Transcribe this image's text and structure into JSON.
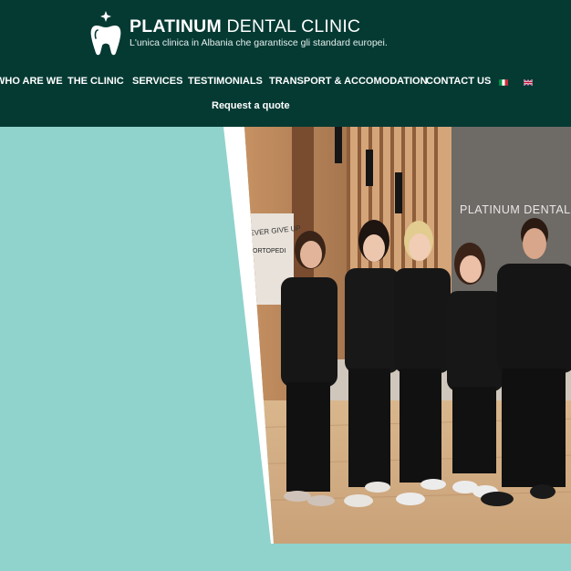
{
  "header": {
    "brand_bold": "PLATINUM",
    "brand_rest": " DENTAL CLINIC",
    "tagline": "L'unica clinica in Albania che garantisce gli standard europei."
  },
  "nav": {
    "items": [
      {
        "label": "WHO ARE WE"
      },
      {
        "label": "THE CLINIC"
      },
      {
        "label": "SERVICES"
      },
      {
        "label": "TESTIMONIALS"
      },
      {
        "label": "TRANSPORT & ACCOMODATION"
      },
      {
        "label": "CONTACT US"
      }
    ],
    "languages": [
      "italian-flag-icon",
      "english-flag-icon"
    ],
    "request_quote": "Request a quote"
  },
  "hero": {
    "wall_sign": "PLATINUM DENTAL",
    "door_sign_1": "NEVER GIVE UP",
    "door_sign_2": "ORTOPEDI"
  },
  "colors": {
    "header_bg": "#053a33",
    "page_bg": "#8fd3cc",
    "text": "#ffffff"
  }
}
